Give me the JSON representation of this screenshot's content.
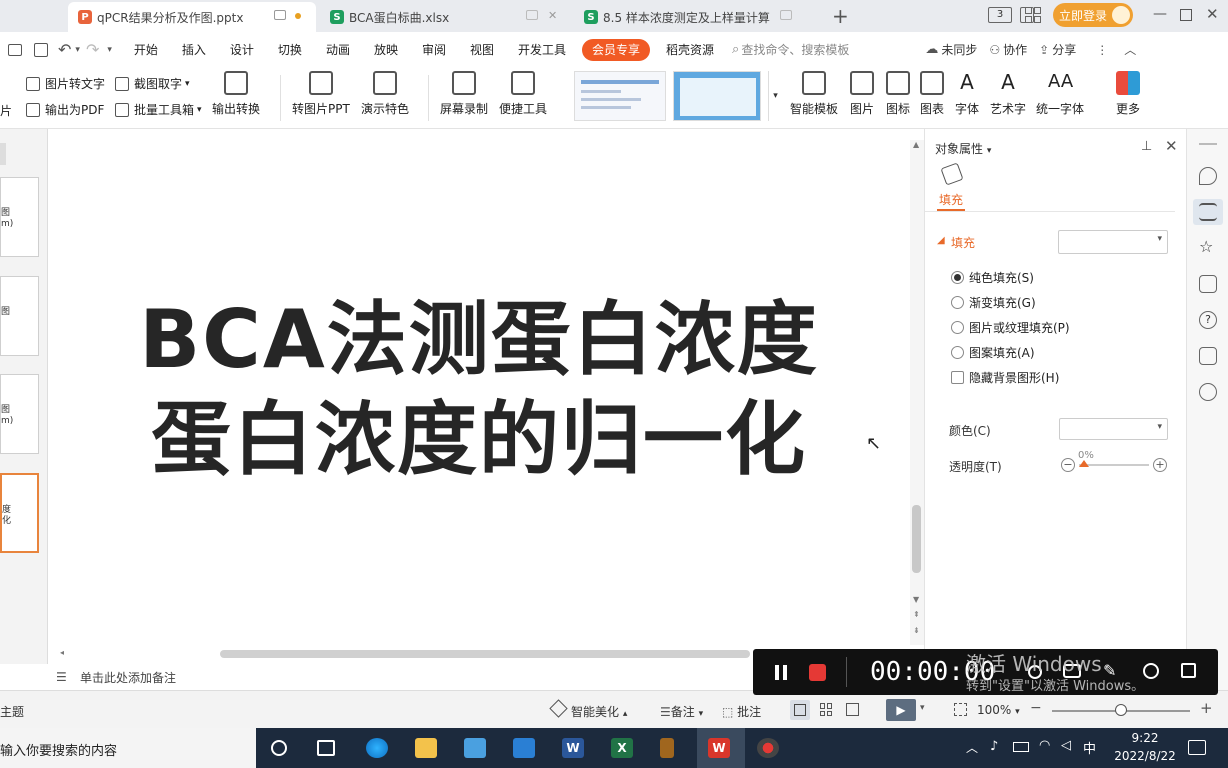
{
  "tabs": [
    {
      "label": "qPCR结果分析及作图.pptx",
      "icon": "P",
      "color": "#e8643c"
    },
    {
      "label": "BCA蛋白标曲.xlsx",
      "icon": "S",
      "color": "#1e9e5e"
    },
    {
      "label": "8.5 样本浓度测定及上样量计算",
      "icon": "S",
      "color": "#1e9e5e"
    }
  ],
  "titlebar": {
    "login": "立即登录"
  },
  "menu": {
    "items": [
      "开始",
      "插入",
      "设计",
      "切换",
      "动画",
      "放映",
      "审阅",
      "视图",
      "开发工具"
    ],
    "member": "会员专享",
    "resource": "稻壳资源",
    "search": "查找命令、搜索模板",
    "sync": "未同步",
    "collab": "协作",
    "share": "分享"
  },
  "ribbon": {
    "img_to_text": "图片转文字",
    "screenshot_text": "截图取字",
    "export_pdf": "输出为PDF",
    "batch_tools": "批量工具箱",
    "output_convert": "输出转换",
    "to_img_ppt": "转图片PPT",
    "show_features": "演示特色",
    "screen_record": "屏幕录制",
    "quick_tools": "便捷工具",
    "smart_template": "智能模板",
    "picture": "图片",
    "icons": "图标",
    "chart": "图表",
    "font": "字体",
    "art_text": "艺术字",
    "unify_font": "统一字体",
    "more": "更多",
    "left_edge": "图片"
  },
  "slide": {
    "line1": "BCA法测蛋白浓度",
    "line2": "蛋白浓度的归一化"
  },
  "thumbs": [
    {
      "t1": "图",
      "t2": "m)"
    },
    {
      "t1": "图",
      "t2": ""
    },
    {
      "t1": "图",
      "t2": "m)"
    },
    {
      "t1": "度",
      "t2": "化"
    }
  ],
  "notes": "单击此处添加备注",
  "panel": {
    "title": "对象属性",
    "tab": "填充",
    "section": "填充",
    "options": [
      "纯色填充(S)",
      "渐变填充(G)",
      "图片或纹理填充(P)",
      "图案填充(A)"
    ],
    "hide_bg": "隐藏背景图形(H)",
    "color_label": "颜色(C)",
    "transparency_label": "透明度(T)",
    "transparency_value": "0%"
  },
  "status": {
    "theme": "主题",
    "beautify": "智能美化",
    "notes": "备注",
    "comment": "批注",
    "zoom": "100%"
  },
  "recorder": {
    "time": "00:00:00"
  },
  "watermark": {
    "line1": "激活 Windows",
    "line2": "转到\"设置\"以激活 Windows。"
  },
  "taskbar": {
    "search": "输入你要搜索的内容",
    "time": "9:22",
    "date": "2022/8/22",
    "ime": "中"
  }
}
